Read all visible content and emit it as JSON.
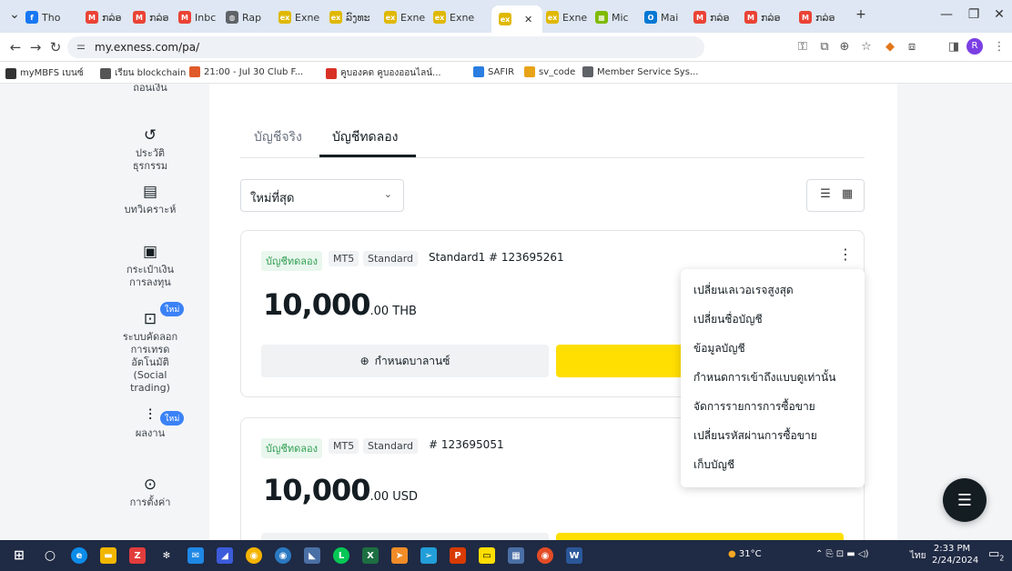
{
  "browser": {
    "tabs": [
      {
        "label": "Tho",
        "icon": "facebook-icon",
        "color": "#1877f2",
        "glyph": "f"
      },
      {
        "label": "ກລ່ອ",
        "icon": "gmail-icon",
        "color": "#ea4335",
        "glyph": "M"
      },
      {
        "label": "ກລ່ອ",
        "icon": "gmail-icon",
        "color": "#ea4335",
        "glyph": "M"
      },
      {
        "label": "Inbc",
        "icon": "gmail-icon",
        "color": "#ea4335",
        "glyph": "M"
      },
      {
        "label": "Rap",
        "icon": "globe-icon",
        "color": "#5f6368",
        "glyph": "◍"
      },
      {
        "label": "Exne",
        "icon": "exness-icon",
        "color": "#e0b800",
        "glyph": "ex"
      },
      {
        "label": "ລົງທະ",
        "icon": "exness-icon",
        "color": "#e0b800",
        "glyph": "ex"
      },
      {
        "label": "Exne",
        "icon": "exness-icon",
        "color": "#e0b800",
        "glyph": "ex"
      },
      {
        "label": "Exne",
        "icon": "exness-icon",
        "color": "#e0b800",
        "glyph": "ex"
      },
      {
        "label": "",
        "icon": "exness-icon",
        "color": "#e0b800",
        "glyph": "ex"
      },
      {
        "label": "Exne",
        "icon": "exness-icon",
        "color": "#e0b800",
        "glyph": "ex"
      },
      {
        "label": "Mic",
        "icon": "microsoft-icon",
        "color": "#7fba00",
        "glyph": "▦"
      },
      {
        "label": "Mai",
        "icon": "outlook-icon",
        "color": "#0078d4",
        "glyph": "O"
      },
      {
        "label": "ກລ່ອ",
        "icon": "gmail-icon",
        "color": "#ea4335",
        "glyph": "M"
      },
      {
        "label": "ກລ່ອ",
        "icon": "gmail-icon",
        "color": "#ea4335",
        "glyph": "M"
      },
      {
        "label": "ກລ່ອ",
        "icon": "gmail-icon",
        "color": "#ea4335",
        "glyph": "M"
      }
    ],
    "url": "my.exness.com/pa/",
    "bookmarks": [
      {
        "label": "myMBFS เบนซ์",
        "color": "#333333"
      },
      {
        "label": "เรียน blockchain",
        "color": "#555555"
      },
      {
        "label": "21:00 - Jul 30 Club F...",
        "color": "#e05a2b"
      },
      {
        "label": "คูบองคด คูบองออนไลน์...",
        "color": "#d93025"
      },
      {
        "label": "SAFIR",
        "color": "#2a7de1"
      },
      {
        "label": "sv_code",
        "color": "#e8a317"
      },
      {
        "label": "Member Service Sys...",
        "color": "#5f6368"
      }
    ]
  },
  "sidebar": {
    "partial_top_label": "ถอนเงิน",
    "items": [
      {
        "label": "ประวัติธุรกรรม",
        "icon": "history-icon",
        "glyph": "↺"
      },
      {
        "label": "บทวิเคราะห์",
        "icon": "analytics-icon",
        "glyph": "▤"
      },
      {
        "label": "กระเป๋าเงินการลงทุน",
        "icon": "wallet-icon",
        "glyph": "▣"
      },
      {
        "label": "ระบบคัดลอกการเทรดอัตโนมัติ (Social trading)",
        "icon": "social-trading-icon",
        "glyph": "⊡"
      },
      {
        "label": "ผลงาน",
        "icon": "performance-icon",
        "glyph": "⫶"
      },
      {
        "label": "การตั้งค่า",
        "icon": "settings-icon",
        "glyph": "⊙"
      }
    ],
    "new_badge": "ใหม่"
  },
  "main": {
    "tabs": [
      "บัญชีจริง",
      "บัญชีทดลอง"
    ],
    "sort_value": "ใหม่ที่สุด",
    "accounts": [
      {
        "type_badge": "บัญชีทดลอง",
        "platform": "MT5",
        "tier": "Standard",
        "name": "Standard1 # 123695261",
        "balance_int": "10,000",
        "balance_dec": ".00 THB",
        "button": "กำหนดบาลานซ์"
      },
      {
        "type_badge": "บัญชีทดลอง",
        "platform": "MT5",
        "tier": "Standard",
        "name": "# 123695051",
        "balance_int": "10,000",
        "balance_dec": ".00 USD",
        "button": ""
      }
    ],
    "menu": [
      "เปลี่ยนเลเวอเรจสูงสุด",
      "เปลี่ยนชื่อบัญชี",
      "ข้อมูลบัญชี",
      "กำหนดการเข้าถึงแบบดูเท่านั้น",
      "จัดการรายการการซื้อขาย",
      "เปลี่ยนรหัสผ่านการซื้อขาย",
      "เก็บบัญชี"
    ]
  },
  "taskbar": {
    "weather": "31°C",
    "lang": "ไทย",
    "time": "2:33 PM",
    "date": "2/24/2024",
    "notif_count": "2"
  }
}
